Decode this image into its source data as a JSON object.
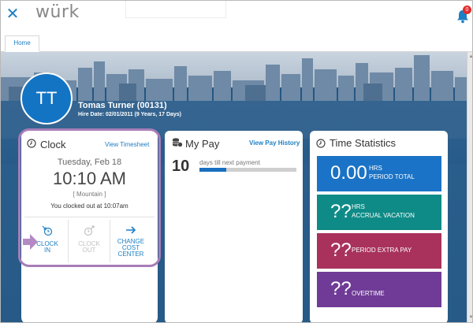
{
  "app": {
    "logo": "würk"
  },
  "header": {
    "notification_count": "0"
  },
  "tabs": [
    {
      "label": "Home"
    }
  ],
  "profile": {
    "initials": "TT",
    "name": "Tomas Turner (00131)",
    "hire_date": "Hire Date: 02/01/2011 (9 Years, 17 Days)"
  },
  "clock": {
    "title": "Clock",
    "link": "View Timesheet",
    "date": "Tuesday, Feb 18",
    "time": "10:10 AM",
    "zone": "[ Mountain ]",
    "status": "You clocked out at 10:07am",
    "actions": [
      {
        "line1": "CLOCK",
        "line2": "IN",
        "line3": ""
      },
      {
        "line1": "CLOCK",
        "line2": "OUT",
        "line3": ""
      },
      {
        "line1": "CHANGE",
        "line2": "COST",
        "line3": "CENTER"
      }
    ]
  },
  "pay": {
    "title": "My Pay",
    "link": "View Pay History",
    "days": "10",
    "days_label": "days till next payment",
    "progress_fraction": 0.28
  },
  "time_stats": {
    "title": "Time Statistics",
    "items": [
      {
        "value": "0.00",
        "unit": "HRS",
        "label": "PERIOD TOTAL",
        "color": "#1a73c6"
      },
      {
        "value": "??",
        "unit": "HRS",
        "label": "ACCRUAL VACATION",
        "color": "#0e8b87"
      },
      {
        "value": "??",
        "unit": "",
        "label": "PERIOD EXTRA PAY",
        "color": "#a8325b"
      },
      {
        "value": "??",
        "unit": "",
        "label": "OVERTIME",
        "color": "#6f3b97"
      }
    ]
  },
  "colors": {
    "accent": "#1d7fc4",
    "highlight": "#a77db8",
    "badge": "#e02d2d"
  }
}
